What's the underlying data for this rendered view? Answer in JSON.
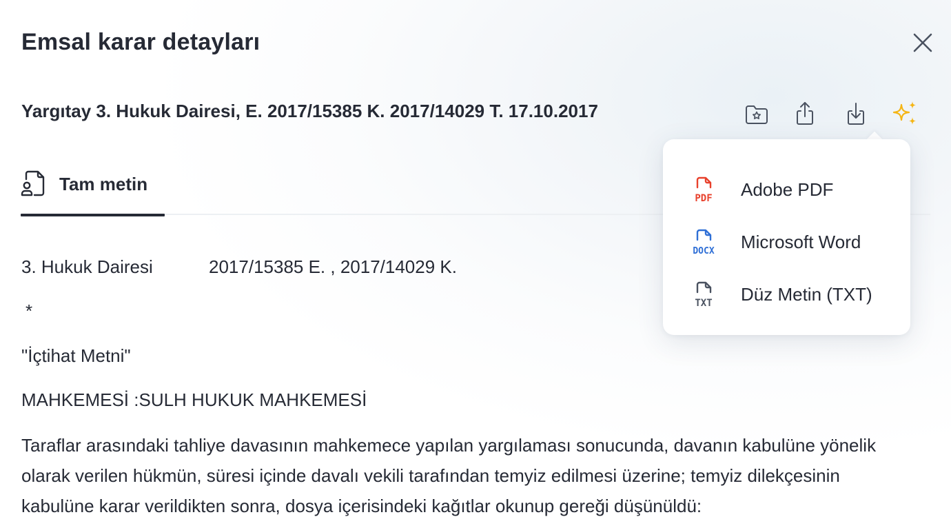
{
  "modal": {
    "title": "Emsal karar detayları"
  },
  "case": {
    "title": "Yargıtay 3. Hukuk Dairesi, E. 2017/15385 K. 2017/14029 T. 17.10.2017"
  },
  "toolbar": {
    "icons": [
      "folder-star-icon",
      "share-icon",
      "download-icon",
      "sparkles-icon"
    ],
    "accent_color": "#f5b514"
  },
  "tabs": [
    {
      "label": "Tam metin",
      "icon": "document-person-icon",
      "active": true
    }
  ],
  "document": {
    "court": "3. Hukuk Dairesi",
    "numbers": "2017/15385 E.  ,  2017/14029 K.",
    "asterisk": "*",
    "ictihat": "\"İçtihat Metni\"",
    "mahkemesi": "MAHKEMESİ :SULH HUKUK MAHKEMESİ",
    "paragraph": "Taraflar arasındaki tahliye davasının mahkemece yapılan yargılaması sonucunda, davanın kabulüne yönelik olarak verilen hükmün, süresi içinde davalı vekili tarafından temyiz edilmesi üzerine; temyiz dilekçesinin kabulüne karar verildikten sonra, dosya içerisindeki kağıtlar okunup gereği düşünüldü:"
  },
  "download_menu": {
    "items": [
      {
        "label": "Adobe PDF",
        "icon_text": "PDF",
        "color": "#e8412c"
      },
      {
        "label": "Microsoft Word",
        "icon_text": "DOCX",
        "color": "#2f6fd6"
      },
      {
        "label": "Düz Metin (TXT)",
        "icon_text": "TXT",
        "color": "#4a5260"
      }
    ]
  }
}
